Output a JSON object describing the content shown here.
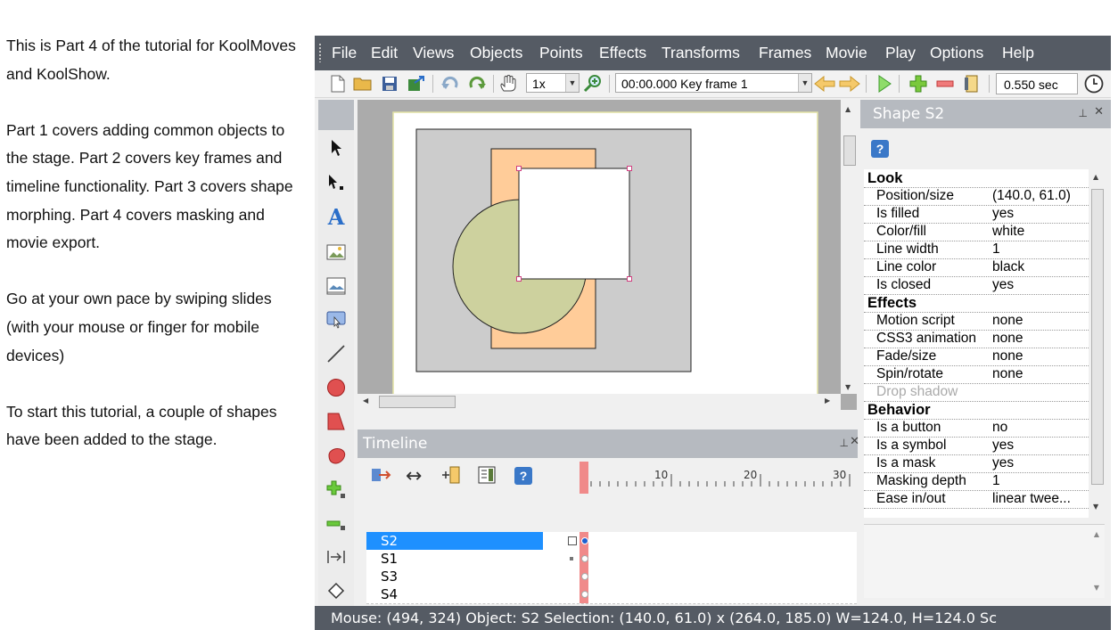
{
  "tutorial": {
    "p1": "This is Part 4 of the tutorial for KoolMoves and KoolShow.",
    "p2": "Part 1 covers adding common objects to the stage. Part 2 covers key frames and timeline functionality. Part 3 covers shape morphing. Part 4 covers masking and movie export.",
    "p3": "Go at your own pace by swiping slides (with your mouse or finger for mobile devices)",
    "p4": "To start this tutorial, a couple of shapes have been added to the stage."
  },
  "menu": [
    "File",
    "Edit",
    "Views",
    "Objects",
    "Points",
    "Effects",
    "Transforms",
    "Frames",
    "Movie",
    "Play",
    "Options",
    "Help"
  ],
  "toolbar": {
    "zoom": "1x",
    "frame": "00:00.000  Key frame 1",
    "duration": "0.550 sec"
  },
  "timeline": {
    "title": "Timeline",
    "ruler": [
      "10",
      "20",
      "30"
    ],
    "layers": [
      "S2",
      "S1",
      "S3",
      "S4"
    ],
    "help": "?"
  },
  "props": {
    "title": "Shape S2",
    "help": "?",
    "rows": [
      {
        "k": "Look",
        "v": "",
        "cat": true
      },
      {
        "k": "Position/size",
        "v": "(140.0, 61.0)"
      },
      {
        "k": "Is filled",
        "v": "yes"
      },
      {
        "k": "Color/fill",
        "v": "white"
      },
      {
        "k": "Line width",
        "v": "1"
      },
      {
        "k": "Line color",
        "v": "black"
      },
      {
        "k": "Is closed",
        "v": "yes"
      },
      {
        "k": "Effects",
        "v": "",
        "cat": true
      },
      {
        "k": "Motion script",
        "v": "none"
      },
      {
        "k": "CSS3 animation",
        "v": "none"
      },
      {
        "k": "Fade/size",
        "v": "none"
      },
      {
        "k": "Spin/rotate",
        "v": "none"
      },
      {
        "k": "Drop shadow",
        "v": "",
        "dis": true
      },
      {
        "k": "Behavior",
        "v": "",
        "cat": true
      },
      {
        "k": "Is a button",
        "v": "no"
      },
      {
        "k": "Is a symbol",
        "v": "yes"
      },
      {
        "k": "Is a mask",
        "v": "yes"
      },
      {
        "k": "Masking depth",
        "v": "1"
      },
      {
        "k": "Ease in/out",
        "v": "linear twee..."
      }
    ]
  },
  "status": "Mouse: (494, 324)  Object: S2  Selection: (140.0, 61.0) x (264.0, 185.0)  W=124.0,  H=124.0  Sc",
  "colors": {
    "titlebar": "#555b64",
    "panel_header": "#b6bac0",
    "selection": "#1e90ff",
    "shape_rect": "#cccccc",
    "shape_orange": "#ffcc99",
    "shape_circle": "#cdd19e",
    "playhead": "#f08a8a"
  }
}
